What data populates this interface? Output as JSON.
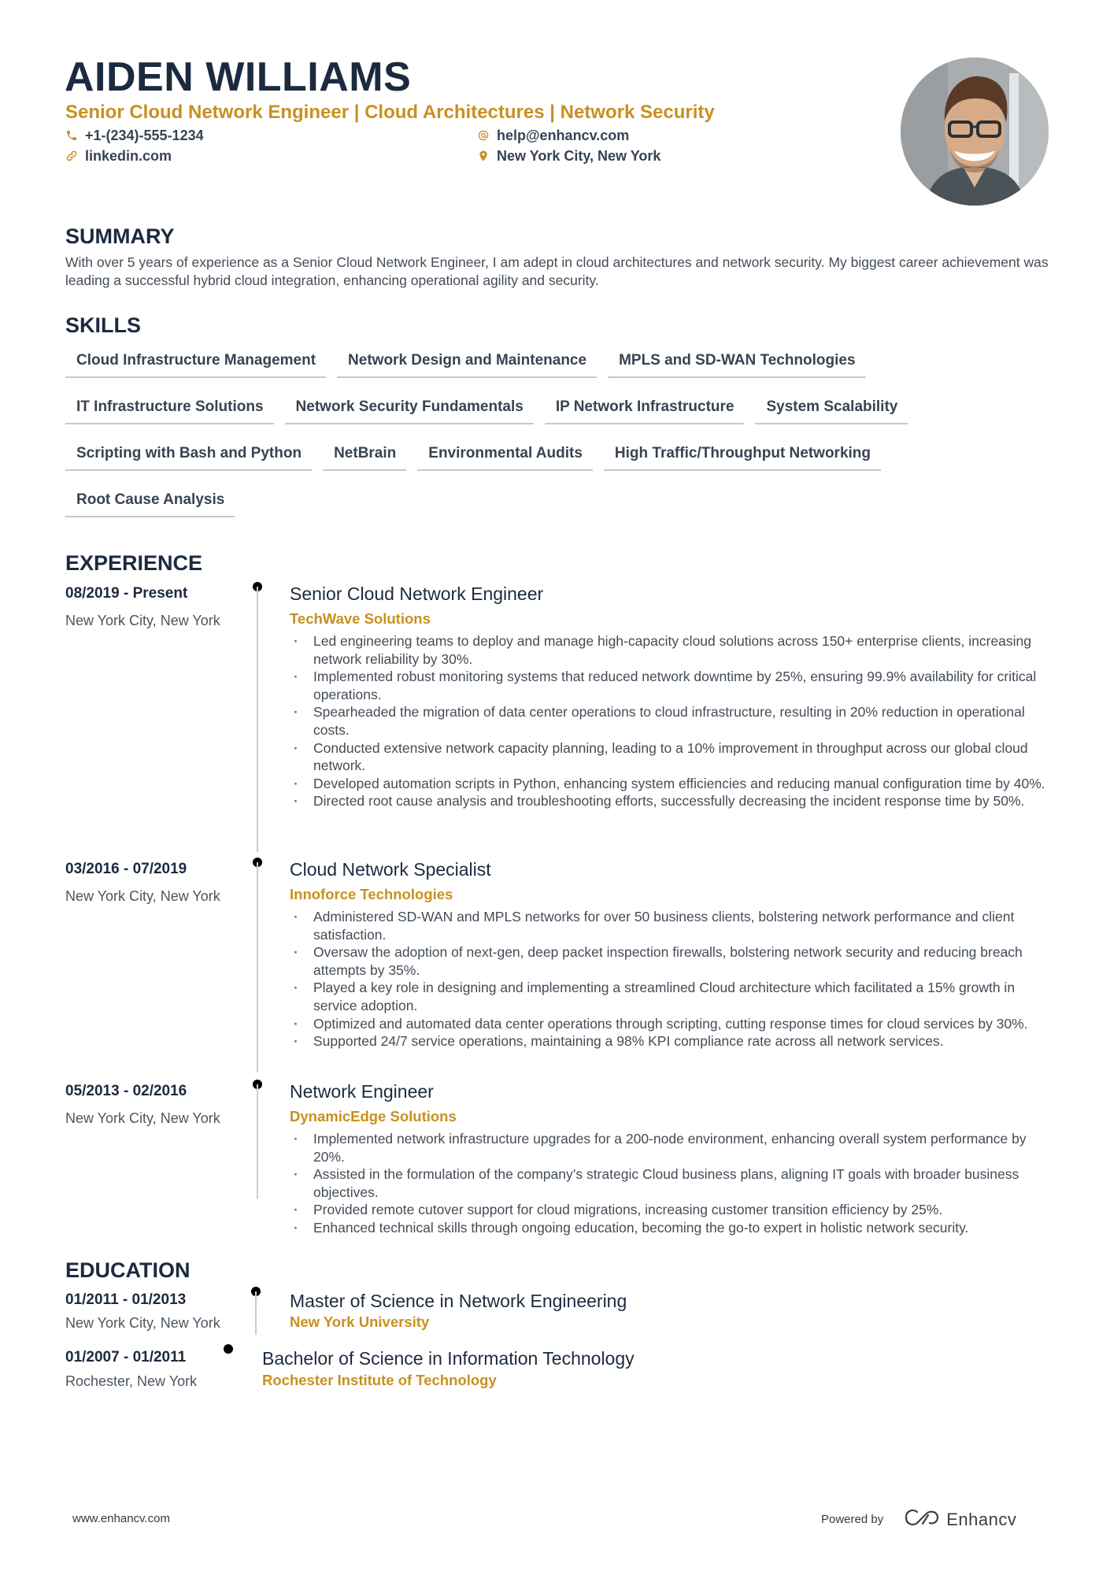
{
  "header": {
    "name": "AIDEN WILLIAMS",
    "headline": "Senior Cloud Network Engineer | Cloud Architectures | Network Security",
    "contacts": {
      "phone": {
        "icon": "phone-icon",
        "value": "+1-(234)-555-1234"
      },
      "email": {
        "icon": "at-icon",
        "value": "help@enhancv.com"
      },
      "linkedin": {
        "icon": "link-icon",
        "value": "linkedin.com"
      },
      "location": {
        "icon": "location-pin-icon",
        "value": "New York City, New York"
      }
    },
    "photo_alt": "Profile photo of Aiden Williams"
  },
  "summary": {
    "title": "SUMMARY",
    "text": "With over 5 years of experience as a Senior Cloud Network Engineer, I am adept in cloud architectures and network security. My biggest career achievement was leading a successful hybrid cloud integration, enhancing operational agility and security."
  },
  "skills": {
    "title": "SKILLS",
    "rows": [
      [
        "Cloud Infrastructure Management",
        "Network Design and Maintenance",
        "MPLS and SD-WAN Technologies"
      ],
      [
        "IT Infrastructure Solutions",
        "Network Security Fundamentals",
        "IP Network Infrastructure",
        "System Scalability"
      ],
      [
        "Scripting with Bash and Python",
        "NetBrain",
        "Environmental Audits",
        "High Traffic/Throughput Networking"
      ],
      [
        "Root Cause Analysis"
      ]
    ]
  },
  "experience": {
    "title": "EXPERIENCE",
    "items": [
      {
        "dates": "08/2019 - Present",
        "location": "New York City, New York",
        "role": "Senior Cloud Network Engineer",
        "company": "TechWave Solutions",
        "bullets": [
          "Led engineering teams to deploy and manage high-capacity cloud solutions across 150+ enterprise clients, increasing network reliability by 30%.",
          "Implemented robust monitoring systems that reduced network downtime by 25%, ensuring 99.9% availability for critical operations.",
          "Spearheaded the migration of data center operations to cloud infrastructure, resulting in 20% reduction in operational costs.",
          "Conducted extensive network capacity planning, leading to a 10% improvement in throughput across our global cloud network.",
          "Developed automation scripts in Python, enhancing system efficiencies and reducing manual configuration time by 40%.",
          "Directed root cause analysis and troubleshooting efforts, successfully decreasing the incident response time by 50%."
        ]
      },
      {
        "dates": "03/2016 - 07/2019",
        "location": "New York City, New York",
        "role": "Cloud Network Specialist",
        "company": "Innoforce Technologies",
        "bullets": [
          "Administered SD-WAN and MPLS networks for over 50 business clients, bolstering network performance and client satisfaction.",
          "Oversaw the adoption of next-gen, deep packet inspection firewalls, bolstering network security and reducing breach attempts by 35%.",
          "Played a key role in designing and implementing a streamlined Cloud architecture which facilitated a 15% growth in service adoption.",
          "Optimized and automated data center operations through scripting, cutting response times for cloud services by 30%.",
          "Supported 24/7 service operations, maintaining a 98% KPI compliance rate across all network services."
        ]
      },
      {
        "dates": "05/2013 - 02/2016",
        "location": "New York City, New York",
        "role": "Network Engineer",
        "company": "DynamicEdge Solutions",
        "bullets": [
          "Implemented network infrastructure upgrades for a 200-node environment, enhancing overall system performance by 20%.",
          "Assisted in the formulation of the company’s strategic Cloud business plans, aligning IT goals with broader business objectives.",
          "Provided remote cutover support for cloud migrations, increasing customer transition efficiency by 25%.",
          "Enhanced technical skills through ongoing education, becoming the go-to expert in holistic network security."
        ]
      }
    ]
  },
  "education": {
    "title": "EDUCATION",
    "items": [
      {
        "dates": "01/2011 - 01/2013",
        "location": "New York City, New York",
        "degree": "Master of Science in Network Engineering",
        "school": "New York University"
      },
      {
        "dates": "01/2007 - 01/2011",
        "location": "Rochester, New York",
        "degree": "Bachelor of Science in Information Technology",
        "school": "Rochester Institute of Technology"
      }
    ]
  },
  "footer": {
    "website": "www.enhancv.com",
    "powered_by": "Powered by",
    "brand": "Enhancv",
    "brand_icon": "enhancv-logo-icon"
  },
  "colors": {
    "heading": "#1c2a3f",
    "accent": "#c8901f",
    "body_text": "#434c57",
    "skill_underline": "#c5c9cd",
    "timeline_line": "#cccccc"
  }
}
